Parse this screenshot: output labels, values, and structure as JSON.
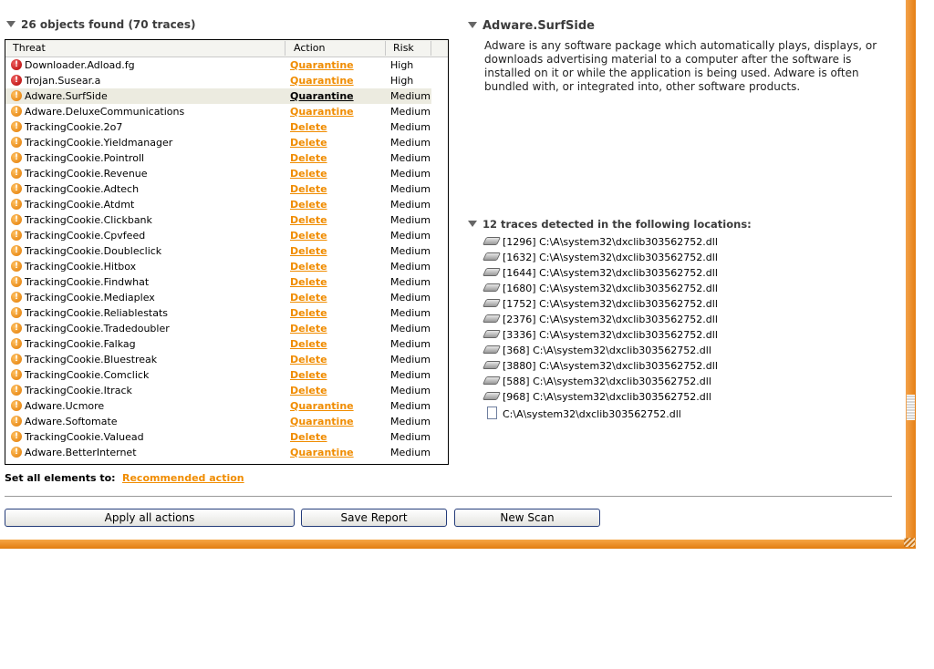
{
  "left_panel": {
    "title": "26 objects found (70 traces)",
    "columns": {
      "threat": "Threat",
      "action": "Action",
      "risk": "Risk"
    },
    "rows": [
      {
        "name": "Downloader.Adload.fg",
        "action": "Quarantine",
        "risk": "High",
        "level": "high"
      },
      {
        "name": "Trojan.Susear.a",
        "action": "Quarantine",
        "risk": "High",
        "level": "high"
      },
      {
        "name": "Adware.SurfSide",
        "action": "Quarantine",
        "risk": "Medium",
        "level": "medium",
        "selected": true
      },
      {
        "name": "Adware.DeluxeCommunications",
        "action": "Quarantine",
        "risk": "Medium",
        "level": "medium"
      },
      {
        "name": "TrackingCookie.2o7",
        "action": "Delete",
        "risk": "Medium",
        "level": "medium"
      },
      {
        "name": "TrackingCookie.Yieldmanager",
        "action": "Delete",
        "risk": "Medium",
        "level": "medium"
      },
      {
        "name": "TrackingCookie.Pointroll",
        "action": "Delete",
        "risk": "Medium",
        "level": "medium"
      },
      {
        "name": "TrackingCookie.Revenue",
        "action": "Delete",
        "risk": "Medium",
        "level": "medium"
      },
      {
        "name": "TrackingCookie.Adtech",
        "action": "Delete",
        "risk": "Medium",
        "level": "medium"
      },
      {
        "name": "TrackingCookie.Atdmt",
        "action": "Delete",
        "risk": "Medium",
        "level": "medium"
      },
      {
        "name": "TrackingCookie.Clickbank",
        "action": "Delete",
        "risk": "Medium",
        "level": "medium"
      },
      {
        "name": "TrackingCookie.Cpvfeed",
        "action": "Delete",
        "risk": "Medium",
        "level": "medium"
      },
      {
        "name": "TrackingCookie.Doubleclick",
        "action": "Delete",
        "risk": "Medium",
        "level": "medium"
      },
      {
        "name": "TrackingCookie.Hitbox",
        "action": "Delete",
        "risk": "Medium",
        "level": "medium"
      },
      {
        "name": "TrackingCookie.Findwhat",
        "action": "Delete",
        "risk": "Medium",
        "level": "medium"
      },
      {
        "name": "TrackingCookie.Mediaplex",
        "action": "Delete",
        "risk": "Medium",
        "level": "medium"
      },
      {
        "name": "TrackingCookie.Reliablestats",
        "action": "Delete",
        "risk": "Medium",
        "level": "medium"
      },
      {
        "name": "TrackingCookie.Tradedoubler",
        "action": "Delete",
        "risk": "Medium",
        "level": "medium"
      },
      {
        "name": "TrackingCookie.Falkag",
        "action": "Delete",
        "risk": "Medium",
        "level": "medium"
      },
      {
        "name": "TrackingCookie.Bluestreak",
        "action": "Delete",
        "risk": "Medium",
        "level": "medium"
      },
      {
        "name": "TrackingCookie.Comclick",
        "action": "Delete",
        "risk": "Medium",
        "level": "medium"
      },
      {
        "name": "TrackingCookie.Itrack",
        "action": "Delete",
        "risk": "Medium",
        "level": "medium"
      },
      {
        "name": "Adware.Ucmore",
        "action": "Quarantine",
        "risk": "Medium",
        "level": "medium"
      },
      {
        "name": "Adware.Softomate",
        "action": "Quarantine",
        "risk": "Medium",
        "level": "medium"
      },
      {
        "name": "TrackingCookie.Valuead",
        "action": "Delete",
        "risk": "Medium",
        "level": "medium"
      },
      {
        "name": "Adware.BetterInternet",
        "action": "Quarantine",
        "risk": "Medium",
        "level": "medium"
      }
    ],
    "set_all_label": "Set all elements to:",
    "set_all_link": "Recommended action"
  },
  "buttons": {
    "apply": "Apply all actions",
    "save": "Save Report",
    "new_scan": "New Scan"
  },
  "detail": {
    "title": "Adware.SurfSide",
    "description": "Adware is any software package which automatically plays, displays, or downloads advertising material to a computer after the software is installed on it or while the application is being used. Adware is often bundled with, or integrated into, other software products.",
    "traces_title": "12 traces detected in the following locations:",
    "traces": [
      {
        "text": "[1296] C:\\A\\system32\\dxclib303562752.dll",
        "icon": "memory-icon"
      },
      {
        "text": "[1632] C:\\A\\system32\\dxclib303562752.dll",
        "icon": "memory-icon"
      },
      {
        "text": "[1644] C:\\A\\system32\\dxclib303562752.dll",
        "icon": "memory-icon"
      },
      {
        "text": "[1680] C:\\A\\system32\\dxclib303562752.dll",
        "icon": "memory-icon"
      },
      {
        "text": "[1752] C:\\A\\system32\\dxclib303562752.dll",
        "icon": "memory-icon"
      },
      {
        "text": "[2376] C:\\A\\system32\\dxclib303562752.dll",
        "icon": "memory-icon"
      },
      {
        "text": "[3336] C:\\A\\system32\\dxclib303562752.dll",
        "icon": "memory-icon"
      },
      {
        "text": "[368] C:\\A\\system32\\dxclib303562752.dll",
        "icon": "memory-icon"
      },
      {
        "text": "[3880] C:\\A\\system32\\dxclib303562752.dll",
        "icon": "memory-icon"
      },
      {
        "text": "[588] C:\\A\\system32\\dxclib303562752.dll",
        "icon": "memory-icon"
      },
      {
        "text": "[968] C:\\A\\system32\\dxclib303562752.dll",
        "icon": "memory-icon"
      },
      {
        "text": "C:\\A\\system32\\dxclib303562752.dll",
        "icon": "file-icon"
      }
    ]
  },
  "colors": {
    "action_link": "#f08c00",
    "frame": "#e8871e",
    "selected_row": "#ecebe0",
    "high_risk": "#c00000",
    "medium_risk": "#f08c00"
  }
}
